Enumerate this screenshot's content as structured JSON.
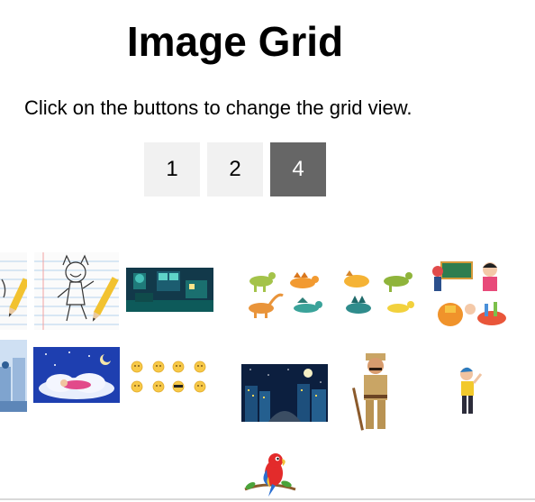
{
  "page": {
    "title": "Image Grid",
    "subtitle": "Click on the buttons to change the grid view."
  },
  "buttons": [
    {
      "label": "1",
      "active": false
    },
    {
      "label": "2",
      "active": false
    },
    {
      "label": "4",
      "active": true
    }
  ],
  "colors": {
    "button_bg": "#f1f1f1",
    "button_active_bg": "#666666",
    "button_active_text": "#ffffff"
  },
  "images": [
    {
      "name": "pencil-notebook-edge-image"
    },
    {
      "name": "sketch-character-notebook-image"
    },
    {
      "name": "night-room-illustration-image"
    },
    {
      "name": "dinosaurs-set-image"
    },
    {
      "name": "dinosaurs-colorful-set-image"
    },
    {
      "name": "back-to-school-kids-image"
    },
    {
      "name": "city-edge-image"
    },
    {
      "name": "sleeping-on-clouds-image"
    },
    {
      "name": "emoji-faces-image"
    },
    {
      "name": "night-city-road-image"
    },
    {
      "name": "police-officer-cartoon-image"
    },
    {
      "name": "boy-waving-cartoon-image"
    },
    {
      "name": "red-parrot-image"
    }
  ]
}
